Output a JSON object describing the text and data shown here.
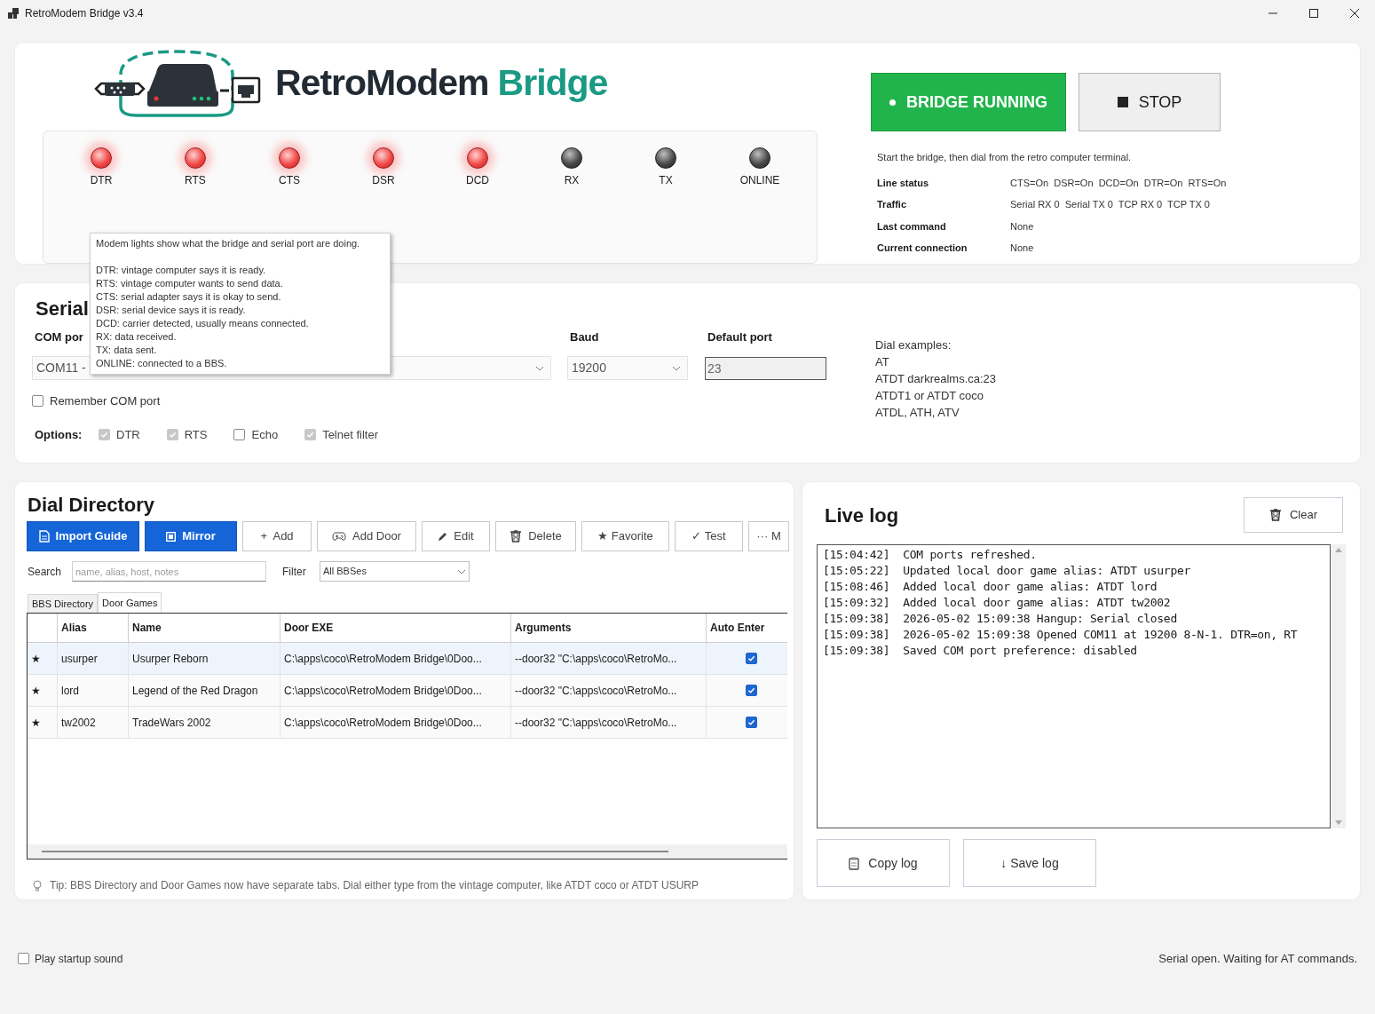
{
  "window": {
    "title": "RetroModem Bridge v3.4"
  },
  "brand": {
    "name": "RetroModem",
    "suffix": "Bridge"
  },
  "lights": [
    {
      "label": "DTR",
      "on": true
    },
    {
      "label": "RTS",
      "on": true
    },
    {
      "label": "CTS",
      "on": true
    },
    {
      "label": "DSR",
      "on": true
    },
    {
      "label": "DCD",
      "on": true
    },
    {
      "label": "RX",
      "on": false
    },
    {
      "label": "TX",
      "on": false
    },
    {
      "label": "ONLINE",
      "on": false
    }
  ],
  "tooltip": {
    "title": "Modem lights show what the bridge and serial port are doing.",
    "lines": [
      "DTR: vintage computer says it is ready.",
      "RTS: vintage computer wants to send data.",
      "CTS: serial adapter says it is okay to send.",
      "DSR: serial device says it is ready.",
      "DCD: carrier detected, usually means connected.",
      "RX: data received.",
      "TX: data sent.",
      "ONLINE: connected to a BBS."
    ]
  },
  "bridge": {
    "running": true,
    "status_button": "BRIDGE RUNNING",
    "stop_button": "STOP",
    "hint": "Start the bridge, then dial from the retro computer terminal.",
    "info": [
      {
        "label": "Line status",
        "value": "CTS=On  DSR=On  DCD=On  DTR=On  RTS=On"
      },
      {
        "label": "Traffic",
        "value": "Serial RX 0  Serial TX 0  TCP RX 0  TCP TX 0"
      },
      {
        "label": "Last command",
        "value": "None"
      },
      {
        "label": "Current connection",
        "value": "None"
      }
    ]
  },
  "serial": {
    "heading": "Serial",
    "com_label": "COM por",
    "com_value": "COM11 -",
    "baud_label": "Baud",
    "baud_value": "19200",
    "port_label": "Default port",
    "port_value": "23",
    "remember": {
      "label": "Remember COM port",
      "checked": false
    },
    "options_label": "Options:",
    "options": [
      {
        "label": "DTR",
        "checked": true
      },
      {
        "label": "RTS",
        "checked": true
      },
      {
        "label": "Echo",
        "checked": false
      },
      {
        "label": "Telnet filter",
        "checked": true
      }
    ],
    "dial_examples": [
      "Dial examples:",
      "AT",
      "ATDT darkrealms.ca:23",
      "ATDT1 or ATDT coco",
      "ATDL, ATH, ATV"
    ]
  },
  "directory": {
    "heading": "Dial Directory",
    "toolbar": [
      {
        "label": "Import Guide",
        "kind": "primary"
      },
      {
        "label": "Mirror",
        "kind": "primary"
      },
      {
        "label": "+  Add",
        "kind": "secondary"
      },
      {
        "label": "Add Door",
        "kind": "secondary"
      },
      {
        "label": "Edit",
        "kind": "secondary"
      },
      {
        "label": "Delete",
        "kind": "secondary"
      },
      {
        "label": "★ Favorite",
        "kind": "secondary"
      },
      {
        "label": "✓ Test",
        "kind": "secondary"
      },
      {
        "label": "··· M",
        "kind": "secondary"
      }
    ],
    "search_label": "Search",
    "search_placeholder": "name, alias, host, notes",
    "filter_label": "Filter",
    "filter_value": "All BBSes",
    "tabs": [
      {
        "label": "BBS Directory",
        "selected": false
      },
      {
        "label": "Door Games",
        "selected": true
      }
    ],
    "columns": [
      "Alias",
      "Name",
      "Door EXE",
      "Arguments",
      "Auto Enter"
    ],
    "rows": [
      {
        "star": "★",
        "alias": "usurper",
        "name": "Usurper Reborn",
        "exe": "C:\\apps\\coco\\RetroModem Bridge\\0Doo...",
        "args": "--door32 \"C:\\apps\\coco\\RetroMo...",
        "auto_enter": true,
        "selected": true
      },
      {
        "star": "★",
        "alias": "lord",
        "name": "Legend of the Red Dragon",
        "exe": "C:\\apps\\coco\\RetroModem Bridge\\0Doo...",
        "args": "--door32 \"C:\\apps\\coco\\RetroMo...",
        "auto_enter": true,
        "selected": false
      },
      {
        "star": "★",
        "alias": "tw2002",
        "name": "TradeWars 2002",
        "exe": "C:\\apps\\coco\\RetroModem Bridge\\0Doo...",
        "args": "--door32 \"C:\\apps\\coco\\RetroMo...",
        "auto_enter": true,
        "selected": false
      }
    ],
    "tip": "Tip: BBS Directory and Door Games now have separate tabs. Dial either type from the vintage computer, like ATDT coco or ATDT USURP"
  },
  "log": {
    "heading": "Live log",
    "clear": "Clear",
    "lines": [
      "[15:04:42]  COM ports refreshed.",
      "[15:05:22]  Updated local door game alias: ATDT usurper",
      "[15:08:46]  Added local door game alias: ATDT lord",
      "[15:09:32]  Added local door game alias: ATDT tw2002",
      "[15:09:38]  2026-05-02 15:09:38 Hangup: Serial closed",
      "[15:09:38]  2026-05-02 15:09:38 Opened COM11 at 19200 8-N-1. DTR=on, RT",
      "[15:09:38]  Saved COM port preference: disabled"
    ],
    "copy": "Copy log",
    "save": "↓ Save log"
  },
  "footer": {
    "sound": {
      "label": "Play startup sound",
      "checked": false
    },
    "status": "Serial open. Waiting for AT commands."
  }
}
